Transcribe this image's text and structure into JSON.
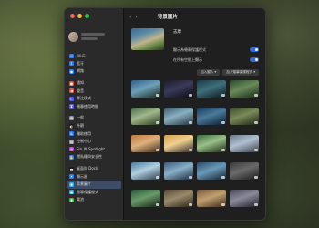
{
  "window": {
    "title": "背景圖片"
  },
  "traffic_lights": {
    "colors": [
      "#ff5f57",
      "#febc2e",
      "#28c840"
    ]
  },
  "sidebar": {
    "items": [
      {
        "label": "Wi-Fi",
        "icon": "wifi-icon",
        "color": "#2b7cf3",
        "glyph": "◠"
      },
      {
        "label": "藍牙",
        "icon": "bluetooth-icon",
        "color": "#2b7cf3",
        "glyph": "ᛒ"
      },
      {
        "label": "網路",
        "icon": "network-icon",
        "color": "#2b7cf3",
        "glyph": "◉"
      },
      {
        "label": "",
        "gap": true
      },
      {
        "label": "通知",
        "icon": "bell-icon",
        "color": "#e5483c",
        "glyph": "●"
      },
      {
        "label": "聲音",
        "icon": "speaker-icon",
        "color": "#e5483c",
        "glyph": "◀"
      },
      {
        "label": "專注模式",
        "icon": "focus-icon",
        "color": "#5b5be0",
        "glyph": "☾"
      },
      {
        "label": "螢幕使用時間",
        "icon": "hourglass-icon",
        "color": "#5b5be0",
        "glyph": "⧗"
      },
      {
        "label": "",
        "gap": true
      },
      {
        "label": "一般",
        "icon": "gear-icon",
        "color": "#8e8e93",
        "glyph": "⚙"
      },
      {
        "label": "外觀",
        "icon": "appearance-icon",
        "color": "#1c1c1c",
        "glyph": "◐"
      },
      {
        "label": "輔助使用",
        "icon": "accessibility-icon",
        "color": "#2b7cf3",
        "glyph": "♿"
      },
      {
        "label": "控制中心",
        "icon": "control-center-icon",
        "color": "#8e8e93",
        "glyph": "▤"
      },
      {
        "label": "Siri 與 Spotlight",
        "icon": "siri-icon",
        "color": "#c447d6",
        "glyph": "◎"
      },
      {
        "label": "隱私權與安全性",
        "icon": "privacy-icon",
        "color": "#2b7cf3",
        "glyph": "✋"
      },
      {
        "label": "",
        "gap": true
      },
      {
        "label": "桌面與 Dock",
        "icon": "dock-icon",
        "color": "#1c1c1c",
        "glyph": "▬"
      },
      {
        "label": "顯示器",
        "icon": "display-icon",
        "color": "#2b7cf3",
        "glyph": "☀"
      },
      {
        "label": "背景圖片",
        "icon": "wallpaper-icon",
        "color": "#37aadc",
        "glyph": "❀",
        "selected": true
      },
      {
        "label": "螢幕保護程式",
        "icon": "screensaver-icon",
        "color": "#37aadc",
        "glyph": "▣"
      },
      {
        "label": "電池",
        "icon": "battery-icon",
        "color": "#3fbf4a",
        "glyph": "▮"
      }
    ]
  },
  "main": {
    "back_glyph": "‹",
    "forward_glyph": "›",
    "current_wallpaper_name": "志摩",
    "option1_label": "顯示為螢幕保護程式",
    "option2_label": "在所有空間上顯示",
    "button1_label": "加入圖片 ▾",
    "button2_label": "加入螢幕保護程式 ▾"
  },
  "wallpapers": [
    {
      "name": "",
      "colors": [
        "#2d5f8a",
        "#6fa0b8",
        "#1a2a1e"
      ]
    },
    {
      "name": "",
      "colors": [
        "#1c1c28",
        "#3a3a5a",
        "#0c0c14"
      ]
    },
    {
      "name": "",
      "colors": [
        "#1a3a4a",
        "#3f6f7a",
        "#0c1a1e"
      ]
    },
    {
      "name": "",
      "colors": [
        "#2a4a2a",
        "#6a8a5a",
        "#1a2a18"
      ]
    },
    {
      "name": "",
      "colors": [
        "#4a6a4a",
        "#a0b88a",
        "#2a3a22"
      ]
    },
    {
      "name": "",
      "colors": [
        "#3a5a6a",
        "#8ab0c0",
        "#20303a"
      ]
    },
    {
      "name": "",
      "colors": [
        "#1a3a5a",
        "#4a7a9a",
        "#0a1a2a"
      ]
    },
    {
      "name": "",
      "colors": [
        "#3a4a2a",
        "#7a8a5a",
        "#1a2212"
      ]
    },
    {
      "name": "",
      "colors": [
        "#c07a3a",
        "#e0b080",
        "#3a2a1a"
      ]
    },
    {
      "name": "",
      "colors": [
        "#d8a050",
        "#f0d090",
        "#2a2a2a"
      ]
    },
    {
      "name": "",
      "colors": [
        "#3a6a3a",
        "#9ac08a",
        "#1a2a14"
      ]
    },
    {
      "name": "",
      "colors": [
        "#6a7a8a",
        "#b0c0d0",
        "#3a4048"
      ]
    },
    {
      "name": "",
      "colors": [
        "#4a7aa0",
        "#b0d0e0",
        "#2a3a4a"
      ]
    },
    {
      "name": "",
      "colors": [
        "#3a5a7a",
        "#8ab0c8",
        "#1a2a3a"
      ]
    },
    {
      "name": "",
      "colors": [
        "#2a4a6a",
        "#6a9ab8",
        "#14202a"
      ]
    },
    {
      "name": "",
      "colors": [
        "#3a3a3a",
        "#6a6a6a",
        "#1a1a1a"
      ]
    },
    {
      "name": "",
      "colors": [
        "#2a5a3a",
        "#6a9a6a",
        "#142014"
      ]
    },
    {
      "name": "",
      "colors": [
        "#5a4a3a",
        "#9a8a6a",
        "#2a2218"
      ]
    },
    {
      "name": "",
      "colors": [
        "#7a5a3a",
        "#c0a070",
        "#3a2a1a"
      ]
    },
    {
      "name": "",
      "colors": [
        "#4a4a5a",
        "#8a8a9a",
        "#1e1e28"
      ]
    }
  ]
}
